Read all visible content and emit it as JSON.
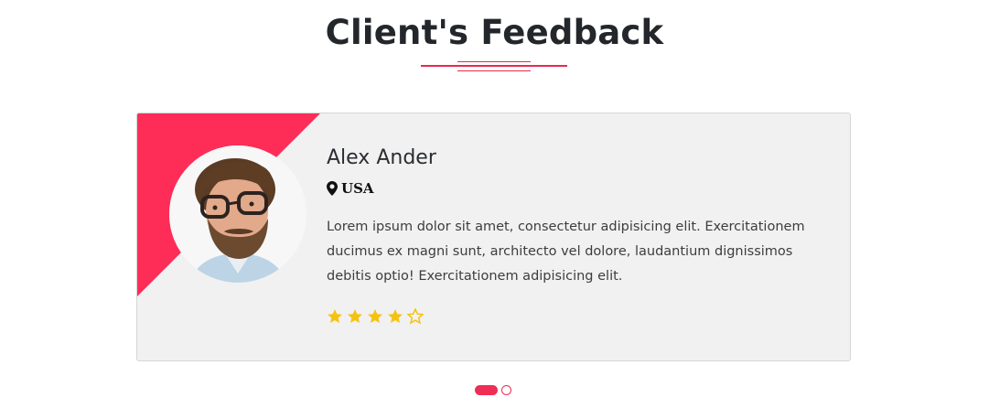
{
  "section": {
    "title": "Client's Feedback"
  },
  "testimonial": {
    "name": "Alex Ander",
    "location": "USA",
    "review": "Lorem ipsum dolor sit amet, consectetur adipisicing elit. Exercitationem ducimus ex magni sunt, architecto vel dolore, laudantium dignissimos debitis optio! Exercitationem adipisicing elit.",
    "rating": 4,
    "rating_max": 5
  },
  "carousel": {
    "slide_count": 2,
    "active_index": 0
  },
  "colors": {
    "accent": "#f02d55",
    "star": "#f5c211",
    "card_bg": "#f1f1f1",
    "heading": "#23272b"
  },
  "icons": {
    "location": "map-pin-icon",
    "star_filled": "star-filled-icon",
    "star_empty": "star-outline-icon"
  }
}
